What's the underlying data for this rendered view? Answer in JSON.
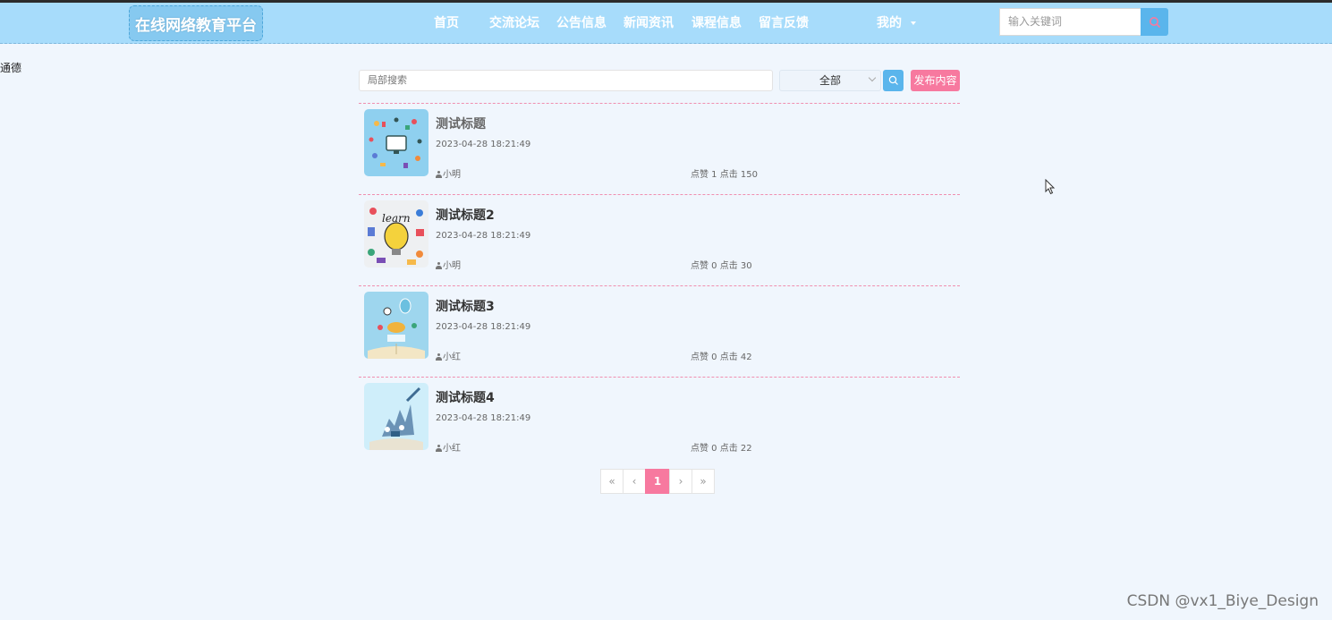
{
  "header": {
    "logo_text": "在线网络教育平台",
    "nav": [
      {
        "label": "首页"
      },
      {
        "label": "交流论坛"
      },
      {
        "label": "公告信息"
      },
      {
        "label": "新闻资讯"
      },
      {
        "label": "课程信息"
      },
      {
        "label": "留言反馈"
      },
      {
        "label": "我的"
      }
    ],
    "search_placeholder": "输入关键词"
  },
  "stray_text": "通德",
  "toolbar": {
    "local_search_placeholder": "局部搜索",
    "select_value": "全部",
    "publish_label": "发布内容"
  },
  "posts": [
    {
      "title": "测试标题",
      "date": "2023-04-28 18:21:49",
      "author": "小明",
      "stats": "点赞 1 点击 150"
    },
    {
      "title": "测试标题2",
      "date": "2023-04-28 18:21:49",
      "author": "小明",
      "stats": "点赞 0 点击 30"
    },
    {
      "title": "测试标题3",
      "date": "2023-04-28 18:21:49",
      "author": "小红",
      "stats": "点赞 0 点击 42"
    },
    {
      "title": "测试标题4",
      "date": "2023-04-28 18:21:49",
      "author": "小红",
      "stats": "点赞 0 点击 22"
    }
  ],
  "pagination": {
    "first": "«",
    "prev": "‹",
    "current": "1",
    "next": "›",
    "last": "»"
  },
  "watermark": "CSDN @vx1_Biye_Design",
  "colors": {
    "navbar": "#a7dcfb",
    "accent_blue": "#5ab5ec",
    "accent_pink": "#f7799f",
    "page_bg": "#f0f6fd"
  }
}
